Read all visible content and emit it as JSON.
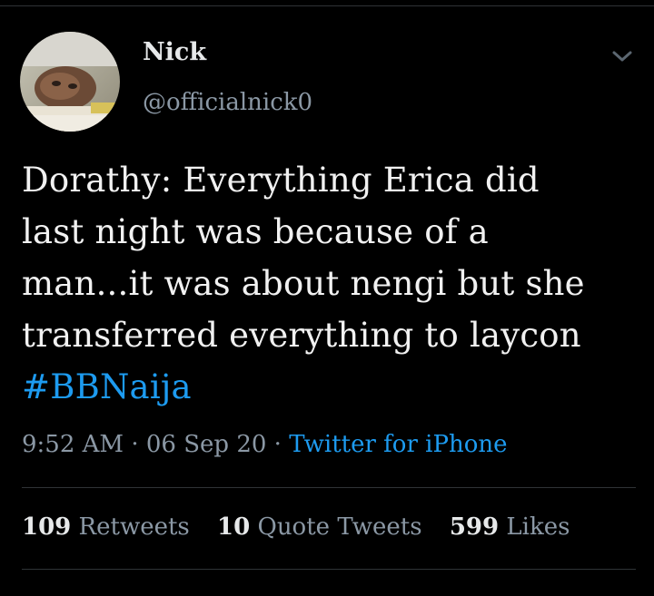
{
  "author": {
    "display_name": "Nick",
    "handle": "@officialnick0",
    "avatar_icon": "profile-photo"
  },
  "menu": {
    "icon": "chevron-down-icon"
  },
  "tweet": {
    "lines": [
      "Dorathy: Everything Erica did",
      "last night was because of a",
      "man...it was about nengi but she",
      "transferred everything to laycon"
    ],
    "hashtag": "#BBNaija"
  },
  "meta": {
    "time": "9:52 AM",
    "separator": "·",
    "date": "06 Sep 20",
    "source": "Twitter for iPhone"
  },
  "stats": {
    "retweets_count": "109",
    "retweets_label": "Retweets",
    "quotes_count": "10",
    "quotes_label": "Quote Tweets",
    "likes_count": "599",
    "likes_label": "Likes"
  },
  "colors": {
    "background": "#000000",
    "text": "#e7e9ea",
    "secondary": "#8b98a5",
    "link": "#1d9bf0",
    "divider": "#2f3336"
  }
}
